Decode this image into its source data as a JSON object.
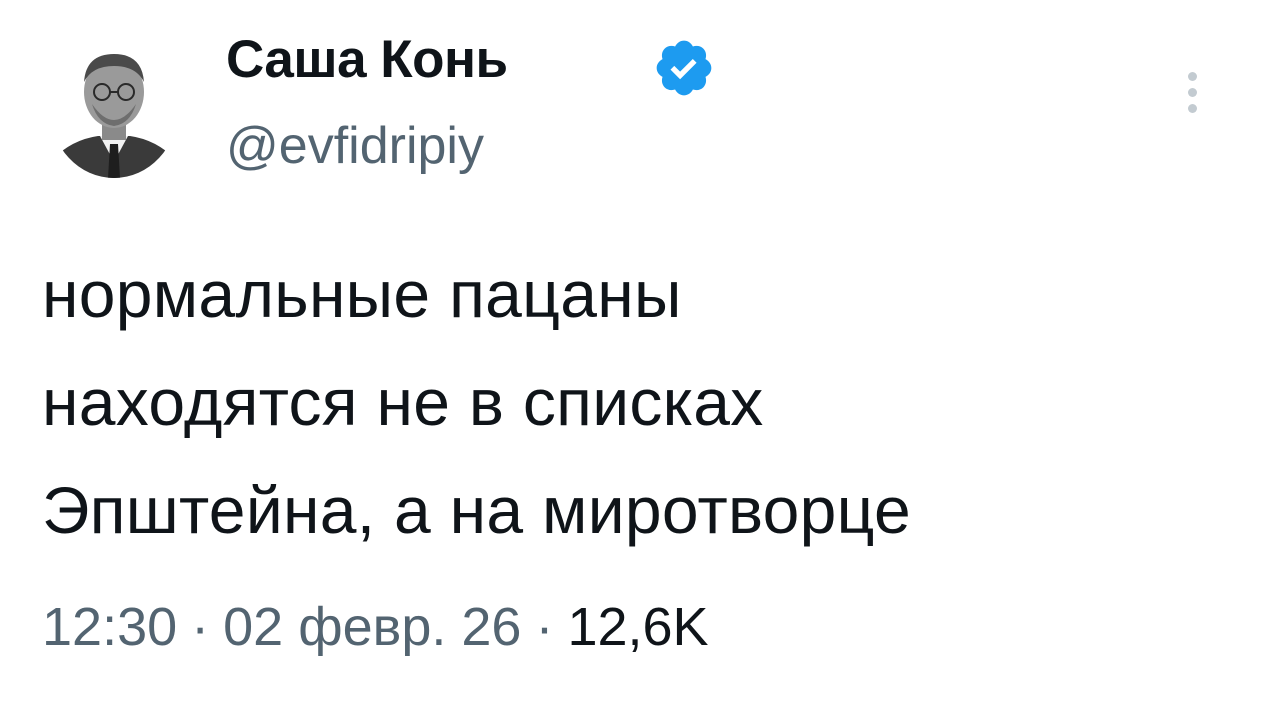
{
  "author": {
    "display_name": "Саша Конь",
    "handle": "@evfidripiy",
    "verified": true,
    "verified_icon": "verified-badge-icon",
    "verified_color": "#1d9bf0"
  },
  "tweet": {
    "text_lines": [
      "нормальные пацаны",
      "находятся не в списках",
      "Эпштейна, а на миротворце"
    ]
  },
  "meta": {
    "time": "12:30",
    "separator": "·",
    "date": "02 февр. 26",
    "views": "12,6K"
  },
  "menu": {
    "icon": "more-options-icon"
  }
}
